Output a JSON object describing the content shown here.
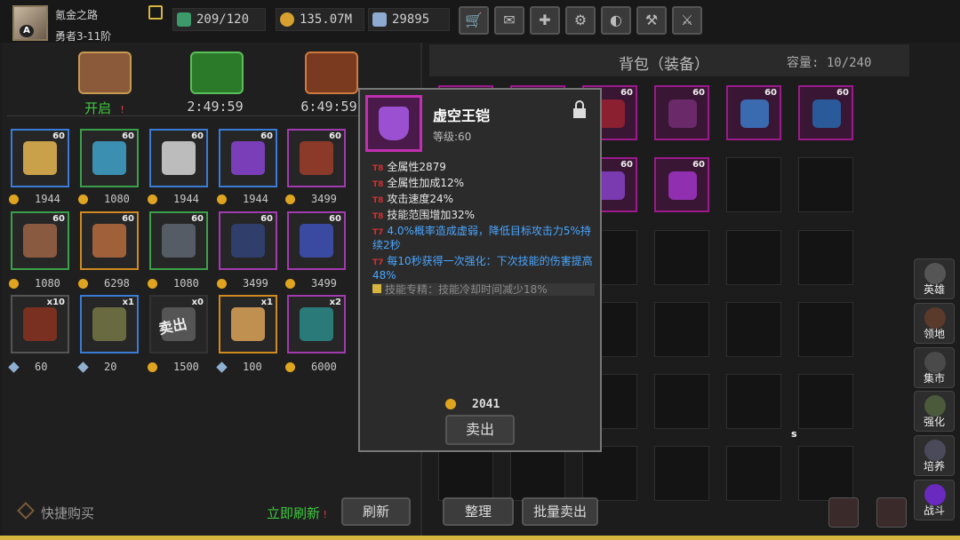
{
  "player": {
    "name": "氪金之路",
    "rank": "勇者3-11阶",
    "avatar_badge": "A"
  },
  "resources": {
    "stamina": "209/120",
    "gold": "135.07M",
    "gems": "29895"
  },
  "top_buttons": [
    "shop-cart-icon",
    "mail-icon",
    "gamepad-icon",
    "gear-icon",
    "rank-icon",
    "hammer-icon",
    "swords-icon"
  ],
  "chests": [
    {
      "label": "开启",
      "status_color": "#3ec93e"
    },
    {
      "label": "2:49:59"
    },
    {
      "label": "6:49:59"
    }
  ],
  "shop_items": [
    {
      "count": "60",
      "price": "1944",
      "currency": "gold",
      "border": "#3a7bd5",
      "art": "#c9a14a"
    },
    {
      "count": "60",
      "price": "1080",
      "currency": "gold",
      "border": "#3aa14a",
      "art": "#3b8fb0"
    },
    {
      "count": "60",
      "price": "1944",
      "currency": "gold",
      "border": "#3a7bd5",
      "art": "#bcbcbc"
    },
    {
      "count": "60",
      "price": "1944",
      "currency": "gold",
      "border": "#3a7bd5",
      "art": "#7a3fb8"
    },
    {
      "count": "60",
      "price": "3499",
      "currency": "gold",
      "border": "#a23ab0",
      "art": "#8b3a2a"
    },
    {
      "count": "60",
      "price": "1080",
      "currency": "gold",
      "border": "#3aa14a",
      "art": "#8a5a40"
    },
    {
      "count": "60",
      "price": "6298",
      "currency": "gold",
      "border": "#d08a20",
      "art": "#a0603a"
    },
    {
      "count": "60",
      "price": "1080",
      "currency": "gold",
      "border": "#3aa14a",
      "art": "#555c66"
    },
    {
      "count": "60",
      "price": "3499",
      "currency": "gold",
      "border": "#a23ab0",
      "art": "#2f3e6a"
    },
    {
      "count": "60",
      "price": "3499",
      "currency": "gold",
      "border": "#a23ab0",
      "art": "#3a4aa0"
    },
    {
      "count": "x10",
      "price": "60",
      "currency": "gem",
      "border": "#555",
      "art": "#7a3020"
    },
    {
      "count": "x1",
      "price": "20",
      "currency": "gem",
      "border": "#3a7bd5",
      "art": "#6a6a40"
    },
    {
      "count": "x0",
      "price": "1500",
      "currency": "gold",
      "border": "#333",
      "art": "#555",
      "sold": "卖出"
    },
    {
      "count": "x1",
      "price": "100",
      "currency": "gem",
      "border": "#d08a20",
      "art": "#c09050"
    },
    {
      "count": "x2",
      "price": "6000",
      "currency": "gold",
      "border": "#a23ab0",
      "art": "#2a7a7a"
    }
  ],
  "left_footer": {
    "quick_buy": "快捷购买",
    "refresh_now": "立即刷新",
    "refresh": "刷新"
  },
  "bag": {
    "title": "背包（装备）",
    "capacity": "容量: 10/240",
    "sort": "整理",
    "bulk_sell": "批量卖出"
  },
  "bag_items": [
    {
      "count": "60",
      "art": "#b040c0"
    },
    {
      "count": "60",
      "art": "#b040c0"
    },
    {
      "count": "60",
      "art": "#8a2030"
    },
    {
      "count": "60",
      "art": "#6a2a6a"
    },
    {
      "count": "60",
      "art": "#3a6ab0"
    },
    {
      "count": "60",
      "art": "#2a5a9a"
    },
    {
      "count": "60",
      "art": "#7a3ab0"
    },
    {
      "count": "60",
      "art": "#9030b0"
    }
  ],
  "side_nav": [
    "英雄",
    "领地",
    "集市",
    "强化",
    "培养",
    "战斗"
  ],
  "tooltip": {
    "name": "虚空王铠",
    "level": "等级:60",
    "stats": [
      {
        "tier": "T8",
        "text": "全属性2879"
      },
      {
        "tier": "T8",
        "text": "全属性加成12%"
      },
      {
        "tier": "T8",
        "text": "攻击速度24%"
      },
      {
        "tier": "T8",
        "text": "技能范围增加32%"
      }
    ],
    "specials": [
      {
        "tier": "T7",
        "text": "4.0%概率造成虚弱，降低目标攻击力5%持续2秒"
      },
      {
        "tier": "T7",
        "text": "每10秒获得一次强化：下次技能的伤害提高48%"
      }
    ],
    "skill": "技能专精：技能冷却时间减少18%",
    "price": "2041",
    "sell": "卖出"
  },
  "cursor_label": "s"
}
